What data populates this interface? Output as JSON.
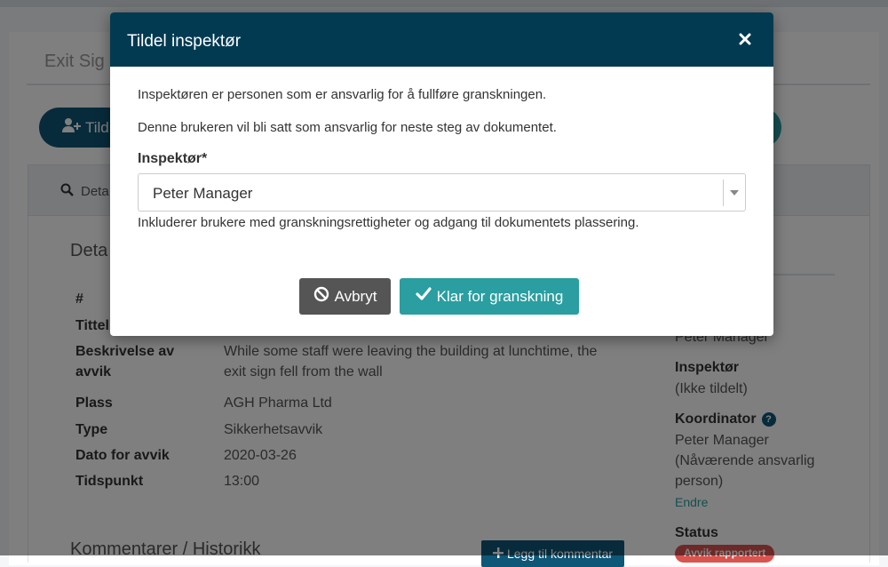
{
  "background": {
    "page_title": "Exit Sig",
    "assign_button_label": "Tild",
    "tab_details_label": "Deta",
    "section_title": "Deta",
    "details": [
      {
        "label": "#",
        "value": ""
      },
      {
        "label": "Tittel",
        "value": ""
      },
      {
        "label": "Beskrivelse av avvik",
        "value": "While some staff were leaving the building at lunchtime, the exit sign fell from the wall"
      },
      {
        "label": "Plass",
        "value": "AGH Pharma Ltd"
      },
      {
        "label": "Type",
        "value": "Sikkerhetsavvik"
      },
      {
        "label": "Dato for avvik",
        "value": "2020-03-26"
      },
      {
        "label": "Tidspunkt",
        "value": "13:00"
      }
    ],
    "side": {
      "reporter_value": "Peter Manager",
      "inspector_label": "Inspektør",
      "inspector_value": "(Ikke tildelt)",
      "coordinator_label": "Koordinator",
      "coordinator_value": "Peter Manager (Nåværende ansvarlig person)",
      "change_link": "Endre",
      "status_label": "Status",
      "status_badge": "Avvik rapportert"
    },
    "comments_title": "Kommentarer / Historikk",
    "add_comment_label": "Legg til kommentar"
  },
  "modal": {
    "title": "Tildel inspektør",
    "description1": "Inspektøren er personen som er ansvarlig for å fullføre granskningen.",
    "description2": "Denne brukeren vil bli satt som ansvarlig for neste steg av dokumentet.",
    "field_label": "Inspektør*",
    "selected_value": "Peter Manager",
    "help_text": "Inkluderer brukere med granskningsrettigheter og adgang til dokumentets plassering.",
    "cancel_label": "Avbryt",
    "confirm_label": "Klar for granskning"
  },
  "icons": {
    "close": "close-icon",
    "cancel": "ban-icon",
    "confirm": "check-icon",
    "add_user": "user-plus-icon",
    "search": "search-icon",
    "help": "question-circle-icon",
    "dropdown": "caret-down-icon"
  },
  "colors": {
    "header": "#023a52",
    "primary": "#0f5777",
    "teal": "#2a9ea0",
    "cancel": "#555555",
    "danger": "#d9534f"
  }
}
